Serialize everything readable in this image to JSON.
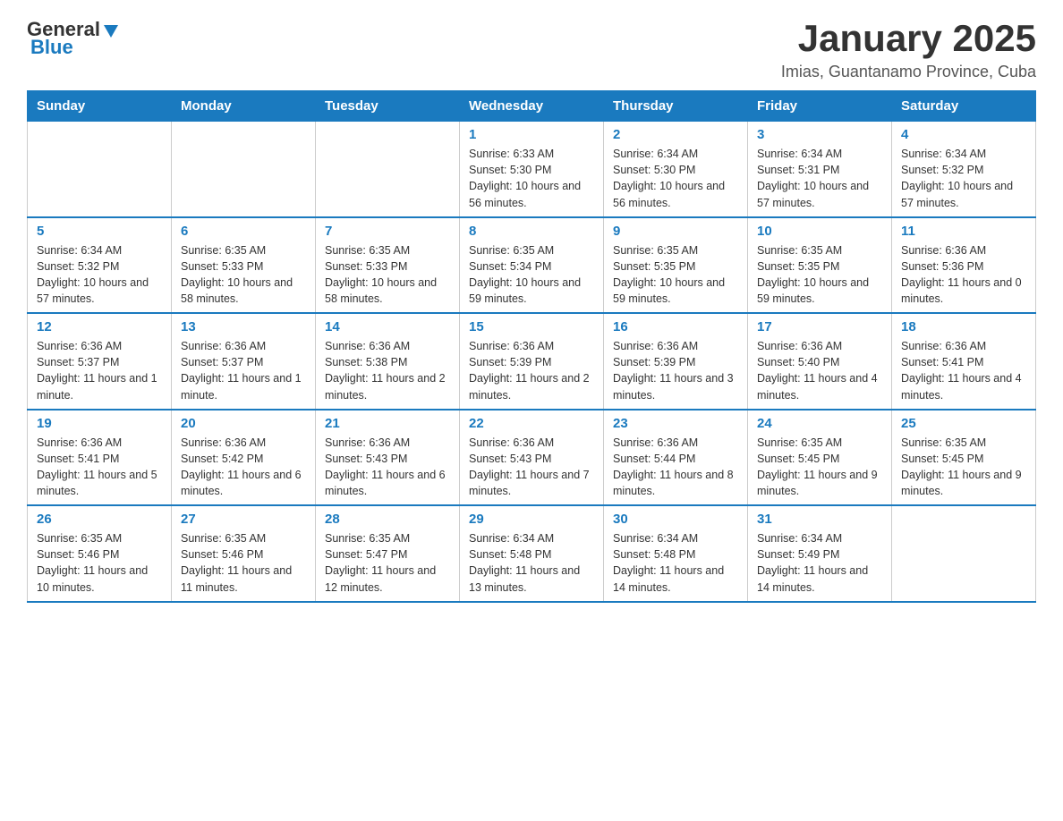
{
  "header": {
    "logo_general": "General",
    "logo_blue": "Blue",
    "month_title": "January 2025",
    "location": "Imias, Guantanamo Province, Cuba"
  },
  "days_of_week": [
    "Sunday",
    "Monday",
    "Tuesday",
    "Wednesday",
    "Thursday",
    "Friday",
    "Saturday"
  ],
  "weeks": [
    [
      {
        "day": "",
        "info": ""
      },
      {
        "day": "",
        "info": ""
      },
      {
        "day": "",
        "info": ""
      },
      {
        "day": "1",
        "info": "Sunrise: 6:33 AM\nSunset: 5:30 PM\nDaylight: 10 hours and 56 minutes."
      },
      {
        "day": "2",
        "info": "Sunrise: 6:34 AM\nSunset: 5:30 PM\nDaylight: 10 hours and 56 minutes."
      },
      {
        "day": "3",
        "info": "Sunrise: 6:34 AM\nSunset: 5:31 PM\nDaylight: 10 hours and 57 minutes."
      },
      {
        "day": "4",
        "info": "Sunrise: 6:34 AM\nSunset: 5:32 PM\nDaylight: 10 hours and 57 minutes."
      }
    ],
    [
      {
        "day": "5",
        "info": "Sunrise: 6:34 AM\nSunset: 5:32 PM\nDaylight: 10 hours and 57 minutes."
      },
      {
        "day": "6",
        "info": "Sunrise: 6:35 AM\nSunset: 5:33 PM\nDaylight: 10 hours and 58 minutes."
      },
      {
        "day": "7",
        "info": "Sunrise: 6:35 AM\nSunset: 5:33 PM\nDaylight: 10 hours and 58 minutes."
      },
      {
        "day": "8",
        "info": "Sunrise: 6:35 AM\nSunset: 5:34 PM\nDaylight: 10 hours and 59 minutes."
      },
      {
        "day": "9",
        "info": "Sunrise: 6:35 AM\nSunset: 5:35 PM\nDaylight: 10 hours and 59 minutes."
      },
      {
        "day": "10",
        "info": "Sunrise: 6:35 AM\nSunset: 5:35 PM\nDaylight: 10 hours and 59 minutes."
      },
      {
        "day": "11",
        "info": "Sunrise: 6:36 AM\nSunset: 5:36 PM\nDaylight: 11 hours and 0 minutes."
      }
    ],
    [
      {
        "day": "12",
        "info": "Sunrise: 6:36 AM\nSunset: 5:37 PM\nDaylight: 11 hours and 1 minute."
      },
      {
        "day": "13",
        "info": "Sunrise: 6:36 AM\nSunset: 5:37 PM\nDaylight: 11 hours and 1 minute."
      },
      {
        "day": "14",
        "info": "Sunrise: 6:36 AM\nSunset: 5:38 PM\nDaylight: 11 hours and 2 minutes."
      },
      {
        "day": "15",
        "info": "Sunrise: 6:36 AM\nSunset: 5:39 PM\nDaylight: 11 hours and 2 minutes."
      },
      {
        "day": "16",
        "info": "Sunrise: 6:36 AM\nSunset: 5:39 PM\nDaylight: 11 hours and 3 minutes."
      },
      {
        "day": "17",
        "info": "Sunrise: 6:36 AM\nSunset: 5:40 PM\nDaylight: 11 hours and 4 minutes."
      },
      {
        "day": "18",
        "info": "Sunrise: 6:36 AM\nSunset: 5:41 PM\nDaylight: 11 hours and 4 minutes."
      }
    ],
    [
      {
        "day": "19",
        "info": "Sunrise: 6:36 AM\nSunset: 5:41 PM\nDaylight: 11 hours and 5 minutes."
      },
      {
        "day": "20",
        "info": "Sunrise: 6:36 AM\nSunset: 5:42 PM\nDaylight: 11 hours and 6 minutes."
      },
      {
        "day": "21",
        "info": "Sunrise: 6:36 AM\nSunset: 5:43 PM\nDaylight: 11 hours and 6 minutes."
      },
      {
        "day": "22",
        "info": "Sunrise: 6:36 AM\nSunset: 5:43 PM\nDaylight: 11 hours and 7 minutes."
      },
      {
        "day": "23",
        "info": "Sunrise: 6:36 AM\nSunset: 5:44 PM\nDaylight: 11 hours and 8 minutes."
      },
      {
        "day": "24",
        "info": "Sunrise: 6:35 AM\nSunset: 5:45 PM\nDaylight: 11 hours and 9 minutes."
      },
      {
        "day": "25",
        "info": "Sunrise: 6:35 AM\nSunset: 5:45 PM\nDaylight: 11 hours and 9 minutes."
      }
    ],
    [
      {
        "day": "26",
        "info": "Sunrise: 6:35 AM\nSunset: 5:46 PM\nDaylight: 11 hours and 10 minutes."
      },
      {
        "day": "27",
        "info": "Sunrise: 6:35 AM\nSunset: 5:46 PM\nDaylight: 11 hours and 11 minutes."
      },
      {
        "day": "28",
        "info": "Sunrise: 6:35 AM\nSunset: 5:47 PM\nDaylight: 11 hours and 12 minutes."
      },
      {
        "day": "29",
        "info": "Sunrise: 6:34 AM\nSunset: 5:48 PM\nDaylight: 11 hours and 13 minutes."
      },
      {
        "day": "30",
        "info": "Sunrise: 6:34 AM\nSunset: 5:48 PM\nDaylight: 11 hours and 14 minutes."
      },
      {
        "day": "31",
        "info": "Sunrise: 6:34 AM\nSunset: 5:49 PM\nDaylight: 11 hours and 14 minutes."
      },
      {
        "day": "",
        "info": ""
      }
    ]
  ]
}
